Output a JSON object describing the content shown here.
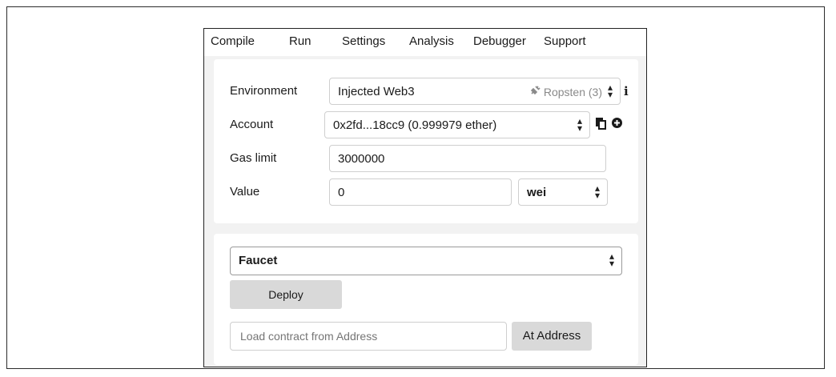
{
  "tabs": {
    "compile": "Compile",
    "run": "Run",
    "settings": "Settings",
    "analysis": "Analysis",
    "debugger": "Debugger",
    "support": "Support"
  },
  "environment": {
    "label": "Environment",
    "value": "Injected Web3",
    "network": "Ropsten (3)",
    "plug_icon": "plug-icon",
    "info_icon": "info-icon"
  },
  "account": {
    "label": "Account",
    "value": "0x2fd...18cc9 (0.999979 ether)",
    "copy_icon": "copy-icon",
    "add_icon": "plus-circle-icon"
  },
  "gas_limit": {
    "label": "Gas limit",
    "value": "3000000"
  },
  "value_field": {
    "label": "Value",
    "value": "0",
    "unit": "wei"
  },
  "contract": {
    "selected": "Faucet",
    "deploy_label": "Deploy",
    "address_placeholder": "Load contract from Address",
    "at_address_label": "At Address"
  },
  "colors": {
    "button_bg": "#d9d9d9",
    "panel_bg": "#f2f2f2",
    "muted_text": "#8a8a8a"
  }
}
